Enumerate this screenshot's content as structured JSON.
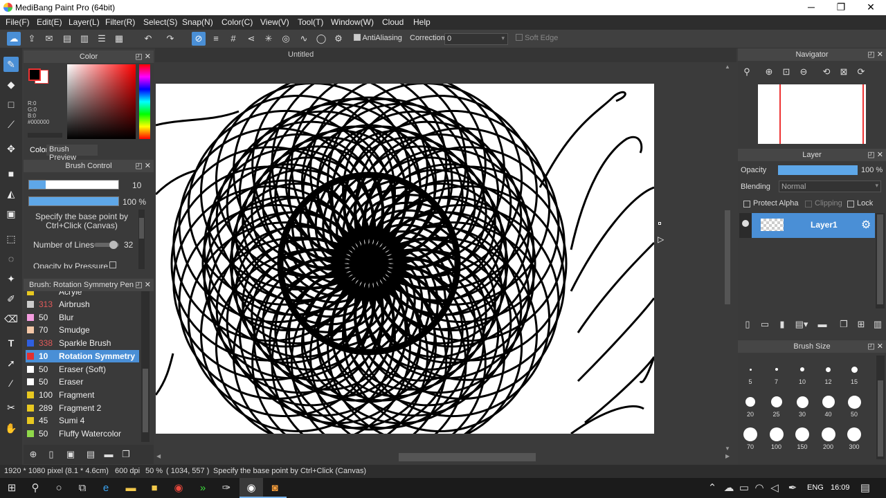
{
  "window": {
    "title": "MediBang Paint Pro (64bit)",
    "minimize": "─",
    "restore": "❐",
    "close": "✕"
  },
  "menu": [
    "File(F)",
    "Edit(E)",
    "Layer(L)",
    "Filter(R)",
    "Select(S)",
    "Snap(N)",
    "Color(C)",
    "View(V)",
    "Tool(T)",
    "Window(W)",
    "Cloud",
    "Help"
  ],
  "toolbar": {
    "antialiasing_label": "AntiAliasing",
    "correction_label": "Correction",
    "correction_value": "0",
    "soft_edge_label": "Soft Edge"
  },
  "document": {
    "tab": "Untitled"
  },
  "color_panel": {
    "title": "Color",
    "readout": [
      "R:0",
      "G:0",
      "B:0",
      "#000000"
    ],
    "tabs": [
      "Color",
      "Brush Preview"
    ],
    "fg_color": "#000000",
    "bg_color": "#ffffff"
  },
  "brush_control": {
    "title": "Brush Control",
    "size_value": "10",
    "opacity_value": "100 %",
    "opacity_fraction": 1.0,
    "hint": "Specify the base point by Ctrl+Click (Canvas)",
    "lines_label": "Number of Lines",
    "lines_value": "32",
    "pressure_label": "Opacity by Pressure"
  },
  "brush_list": {
    "title": "Brush: Rotation Symmetry Pen",
    "partial_top": "Acryle",
    "items": [
      {
        "num": "313",
        "name": "Airbrush",
        "color": "#cccccc",
        "numcolor": "#e05a5a"
      },
      {
        "num": "50",
        "name": "Blur",
        "color": "#f59de0",
        "numcolor": "#eeeeee"
      },
      {
        "num": "70",
        "name": "Smudge",
        "color": "#f3c7a7",
        "numcolor": "#eeeeee"
      },
      {
        "num": "338",
        "name": "Sparkle Brush",
        "color": "#2f5fe0",
        "numcolor": "#e05a5a"
      },
      {
        "num": "10",
        "name": "Rotation Symmetry",
        "color": "#e33030",
        "numcolor": "#ffffff",
        "selected": true
      },
      {
        "num": "50",
        "name": "Eraser (Soft)",
        "color": "#ffffff",
        "numcolor": "#eeeeee"
      },
      {
        "num": "50",
        "name": "Eraser",
        "color": "#ffffff",
        "numcolor": "#eeeeee"
      },
      {
        "num": "100",
        "name": "Fragment",
        "color": "#e8c820",
        "numcolor": "#eeeeee"
      },
      {
        "num": "289",
        "name": "Fragment 2",
        "color": "#e8c820",
        "numcolor": "#eeeeee"
      },
      {
        "num": "45",
        "name": "Sumi 4",
        "color": "#e8c820",
        "numcolor": "#eeeeee"
      },
      {
        "num": "50",
        "name": "Fluffy Watercolor",
        "color": "#8fd84a",
        "numcolor": "#eeeeee"
      }
    ]
  },
  "navigator": {
    "title": "Navigator"
  },
  "layer_panel": {
    "title": "Layer",
    "opacity_label": "Opacity",
    "opacity_value": "100 %",
    "opacity_fraction": 1.0,
    "blending_label": "Blending",
    "blending_value": "Normal",
    "protect_alpha": "Protect Alpha",
    "clipping": "Clipping",
    "lock": "Lock",
    "layer_name": "Layer1"
  },
  "brush_size": {
    "title": "Brush Size",
    "sizes": [
      "5",
      "7",
      "10",
      "12",
      "15",
      "20",
      "25",
      "30",
      "40",
      "50",
      "70",
      "100",
      "150",
      "200",
      "300"
    ]
  },
  "status": {
    "dimensions": "1920 * 1080 pixel",
    "physical": "(8.1 * 4.6cm)",
    "dpi": "600 dpi",
    "zoom": "50 %",
    "coords": "( 1034, 557 )",
    "hint": "Specify the base point by Ctrl+Click (Canvas)"
  },
  "taskbar": {
    "language": "ENG",
    "time": "16:09"
  }
}
